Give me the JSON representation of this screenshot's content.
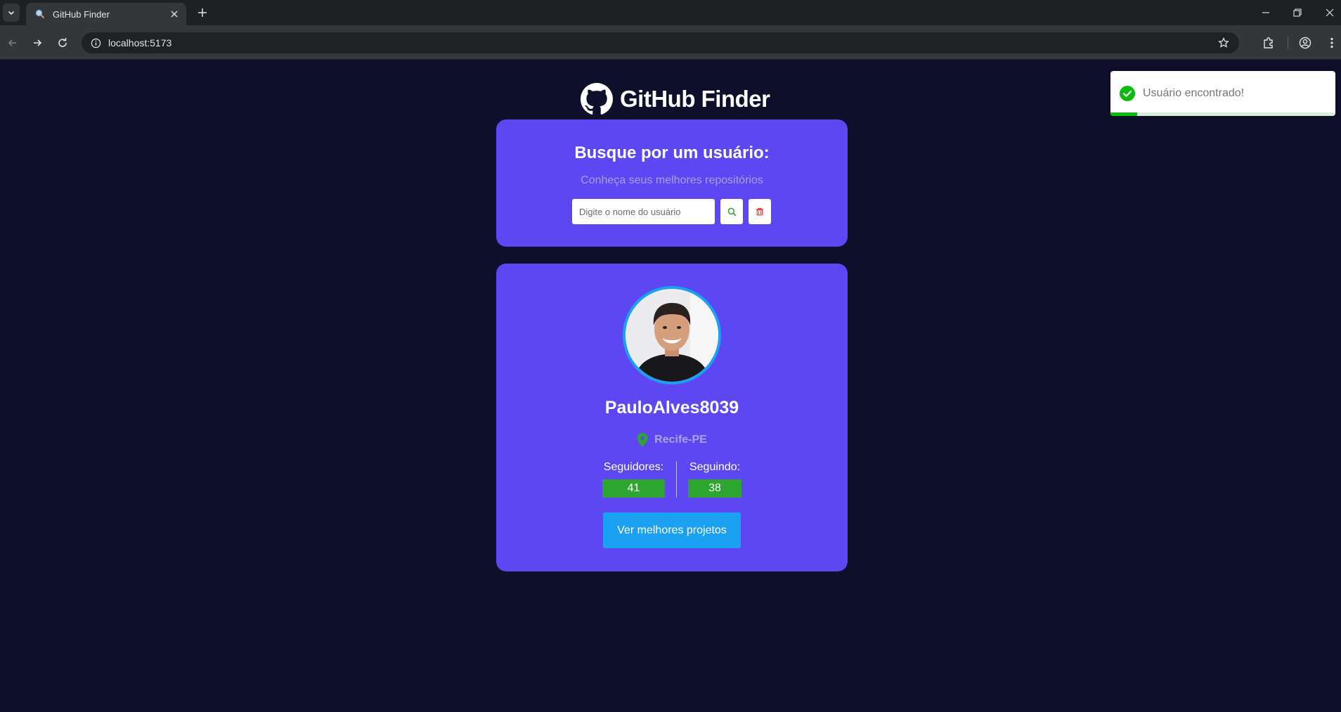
{
  "browser": {
    "tab_title": "GitHub Finder",
    "url": "localhost:5173"
  },
  "brand": {
    "title": "GitHub Finder",
    "logo_icon": "github-octocat-icon"
  },
  "search": {
    "title": "Busque por um usuário:",
    "subtitle": "Conheça seus melhores repositórios",
    "input_placeholder": "Digite o nome do usuário",
    "input_value": "",
    "search_button_icon": "search-icon",
    "clear_button_icon": "trash-icon"
  },
  "profile": {
    "avatar_alt": "PauloAlves8039",
    "username": "PauloAlves8039",
    "location": "Recife-PE",
    "followers_label": "Seguidores:",
    "followers": "41",
    "following_label": "Seguindo:",
    "following": "38",
    "projects_button": "Ver melhores projetos"
  },
  "toast": {
    "message": "Usuário encontrado!",
    "icon": "check-circle-icon",
    "progress_remaining": 0.12
  },
  "colors": {
    "page_bg": "#0e0f2b",
    "card_bg": "#5c47f2",
    "accent_blue": "#1ba1f2",
    "stat_green": "#2ca531",
    "toast_green": "#07bc0c"
  }
}
